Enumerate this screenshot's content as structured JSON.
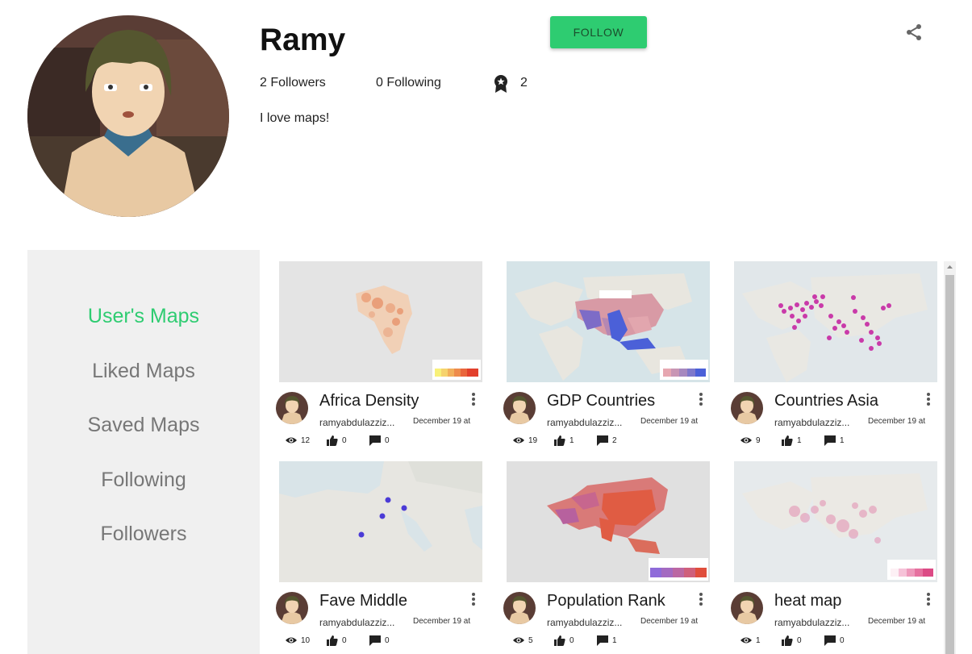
{
  "profile": {
    "name": "Ramy",
    "follow_label": "FOLLOW",
    "followers": "2 Followers",
    "following": "0 Following",
    "badges": "2",
    "bio": "I love maps!"
  },
  "nav": [
    {
      "label": "User's Maps",
      "active": true
    },
    {
      "label": "Liked Maps"
    },
    {
      "label": "Saved Maps"
    },
    {
      "label": "Following"
    },
    {
      "label": "Followers"
    }
  ],
  "cards": [
    {
      "title": "Africa Density",
      "author": "ramyabdulazziz...",
      "date": "December 19 at",
      "views": "12",
      "likes": "0",
      "comments": "0"
    },
    {
      "title": "GDP Countries",
      "author": "ramyabdulazziz...",
      "date": "December 19 at",
      "views": "19",
      "likes": "1",
      "comments": "2"
    },
    {
      "title": "Countries Asia",
      "author": "ramyabdulazziz...",
      "date": "December 19 at",
      "views": "9",
      "likes": "1",
      "comments": "1"
    },
    {
      "title": "Fave Middle",
      "author": "ramyabdulazziz...",
      "date": "December 19 at",
      "views": "10",
      "likes": "0",
      "comments": "0"
    },
    {
      "title": "Population Rank",
      "author": "ramyabdulazziz...",
      "date": "December 19 at",
      "views": "5",
      "likes": "0",
      "comments": "1"
    },
    {
      "title": "heat map",
      "author": "ramyabdulazziz...",
      "date": "December 19 at",
      "views": "1",
      "likes": "0",
      "comments": "0"
    }
  ],
  "icons": {
    "share": "share-icon",
    "badge": "award-icon",
    "views": "eye-icon",
    "likes": "thumb-up-icon",
    "comments": "comment-icon",
    "menu": "more-vert-icon"
  },
  "colors": {
    "accent": "#2ecc71",
    "nav_inactive": "#777777",
    "sidebar_bg": "#f0f0f0"
  }
}
